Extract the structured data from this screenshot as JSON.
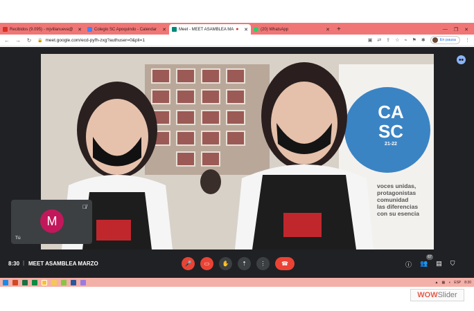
{
  "browser": {
    "tabs": [
      {
        "label": "Recibidos (9.095) - mjvillanueva@",
        "favicon_color": "#d93025",
        "active": false
      },
      {
        "label": "Colegio SC Apoquindo - Calendar",
        "favicon_color": "#4285f4",
        "active": false
      },
      {
        "label": "Meet - MEET ASAMBLEA MA",
        "favicon_color": "#00897b",
        "active": true
      },
      {
        "label": "(20) WhatsApp",
        "favicon_color": "#25d366",
        "active": false
      }
    ],
    "new_tab_symbol": "+",
    "url": "meet.google.com/ecd-pyfh-zxg?authuser=0&pli=1",
    "profile_status": "En pausa"
  },
  "meet": {
    "self_tile": {
      "initial": "M",
      "name": "Tú"
    },
    "time": "8:30",
    "meeting_name": "MEET ASAMBLEA MARZO",
    "participants_count": "67",
    "controls": [
      "mic-off-icon",
      "camera-off-icon",
      "raise-hand-icon",
      "present-icon",
      "more-icon",
      "hangup-icon"
    ],
    "video_banner": {
      "logo_top": "CA",
      "logo_bottom": "SC",
      "logo_year": "21-22",
      "text_lines": [
        "voces unidas,",
        "protagonistas",
        "comunidad",
        "las diferencias",
        "con su esencia"
      ]
    }
  },
  "taskbar": {
    "lang": "ESP",
    "clock": "8:30"
  },
  "watermark": {
    "wow": "WOW",
    "slider": "Slider"
  },
  "colors": {
    "tabstrip": "#f07676",
    "meet_bg": "#202124",
    "accent_red": "#ea4335",
    "avatar": "#c2185b"
  }
}
